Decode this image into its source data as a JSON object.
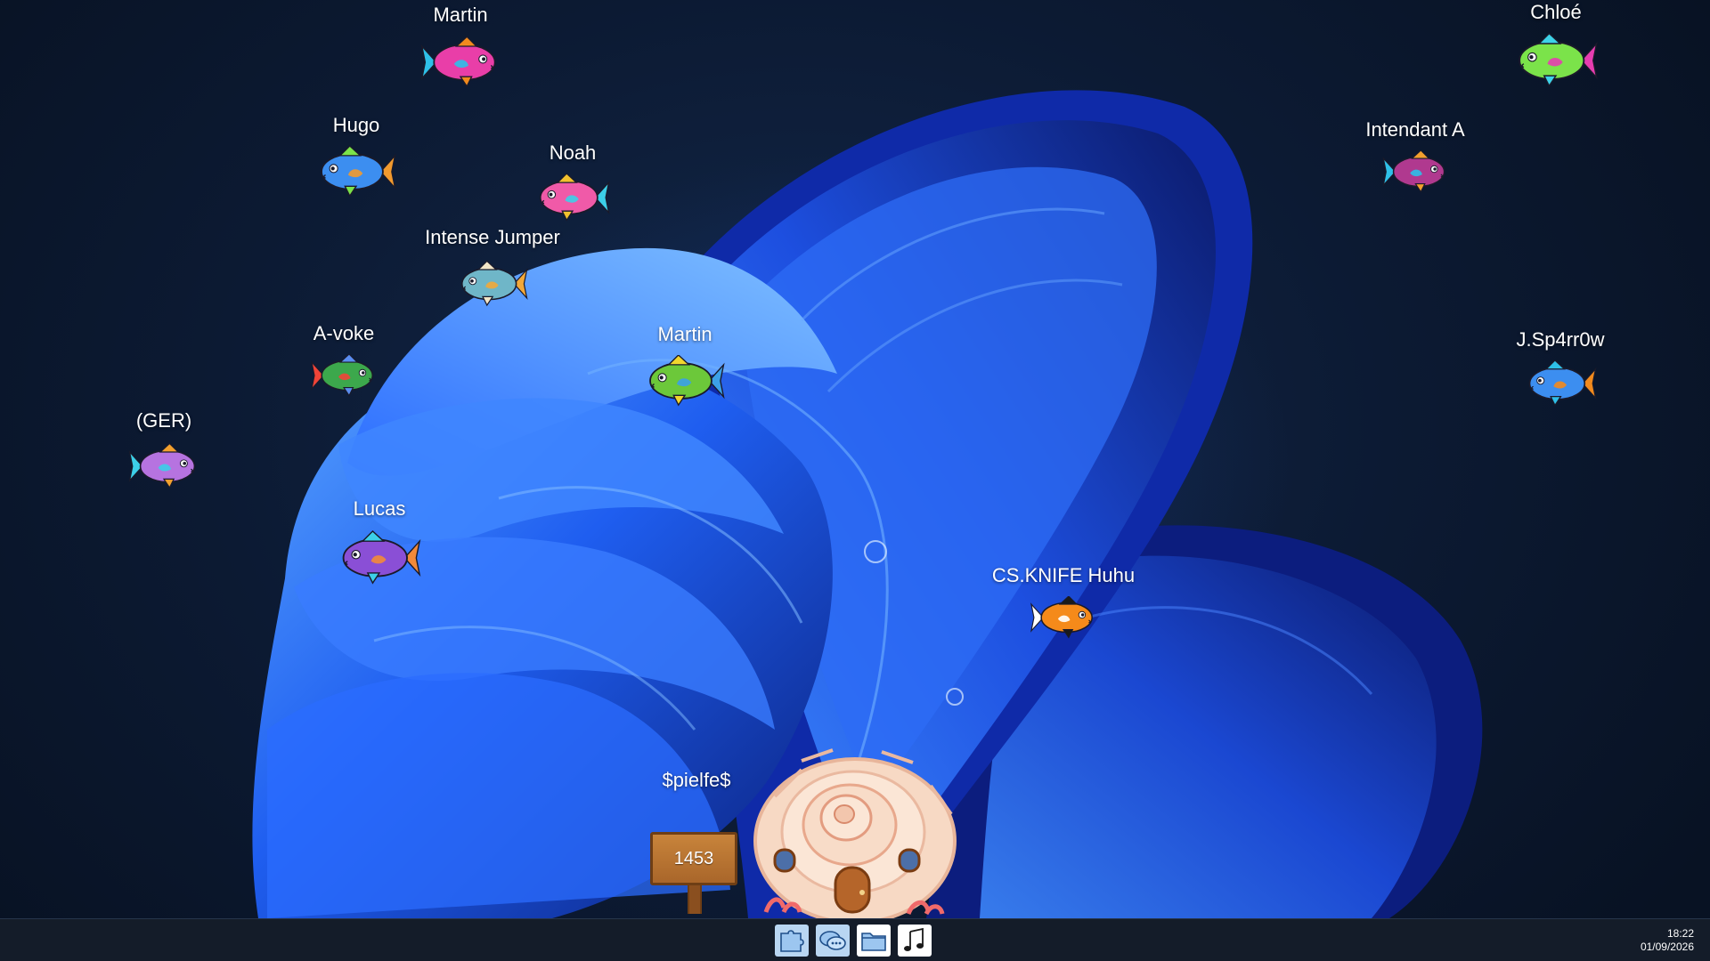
{
  "desktop": {
    "fish": [
      {
        "name": "Martin",
        "palette": [
          "#e93ea8",
          "#2ec0e8",
          "#f28a1d"
        ]
      },
      {
        "name": "Chloé",
        "palette": [
          "#7be34a",
          "#e63db0",
          "#3dd2e8"
        ]
      },
      {
        "name": "Hugo",
        "palette": [
          "#3c8ef0",
          "#f29a2e",
          "#7be34a"
        ]
      },
      {
        "name": "Noah",
        "palette": [
          "#f05aa8",
          "#3ccfe8",
          "#f2c12e"
        ]
      },
      {
        "name": "Intendant A",
        "palette": [
          "#b0398f",
          "#2ec0e8",
          "#f2a02e"
        ]
      },
      {
        "name": "Intense Jumper",
        "palette": [
          "#6fb6c8",
          "#f2a83a",
          "#f2e6c8"
        ]
      },
      {
        "name": "A-voke",
        "palette": [
          "#3ca84c",
          "#f04438",
          "#5a8df0"
        ]
      },
      {
        "name": "Martin",
        "palette": [
          "#6cc83a",
          "#3ca0e8",
          "#f2d62e"
        ]
      },
      {
        "name": "J.Sp4rr0w",
        "palette": [
          "#3c8ef0",
          "#f28a1d",
          "#2ec0e8"
        ]
      },
      {
        "name": "(GER)",
        "palette": [
          "#b673e0",
          "#3ccfe8",
          "#f2a02e"
        ]
      },
      {
        "name": "Lucas",
        "palette": [
          "#8a4fd6",
          "#f28a3a",
          "#3ccfe8"
        ]
      },
      {
        "name": "CS.KNIFE Huhu",
        "palette": [
          "#f58a1a",
          "#ffffff",
          "#1a1a1a"
        ]
      }
    ],
    "sign": {
      "owner": "$pielfe$",
      "value": "1453"
    }
  },
  "taskbar": {
    "apps": [
      {
        "icon": "puzzle-icon",
        "label": "puzzle"
      },
      {
        "icon": "chat-icon",
        "label": "chat"
      },
      {
        "icon": "folder-icon",
        "label": "folder"
      },
      {
        "icon": "music-icon",
        "label": "music"
      }
    ],
    "clock": {
      "time": "18:22",
      "date": "01/09/2026"
    }
  }
}
